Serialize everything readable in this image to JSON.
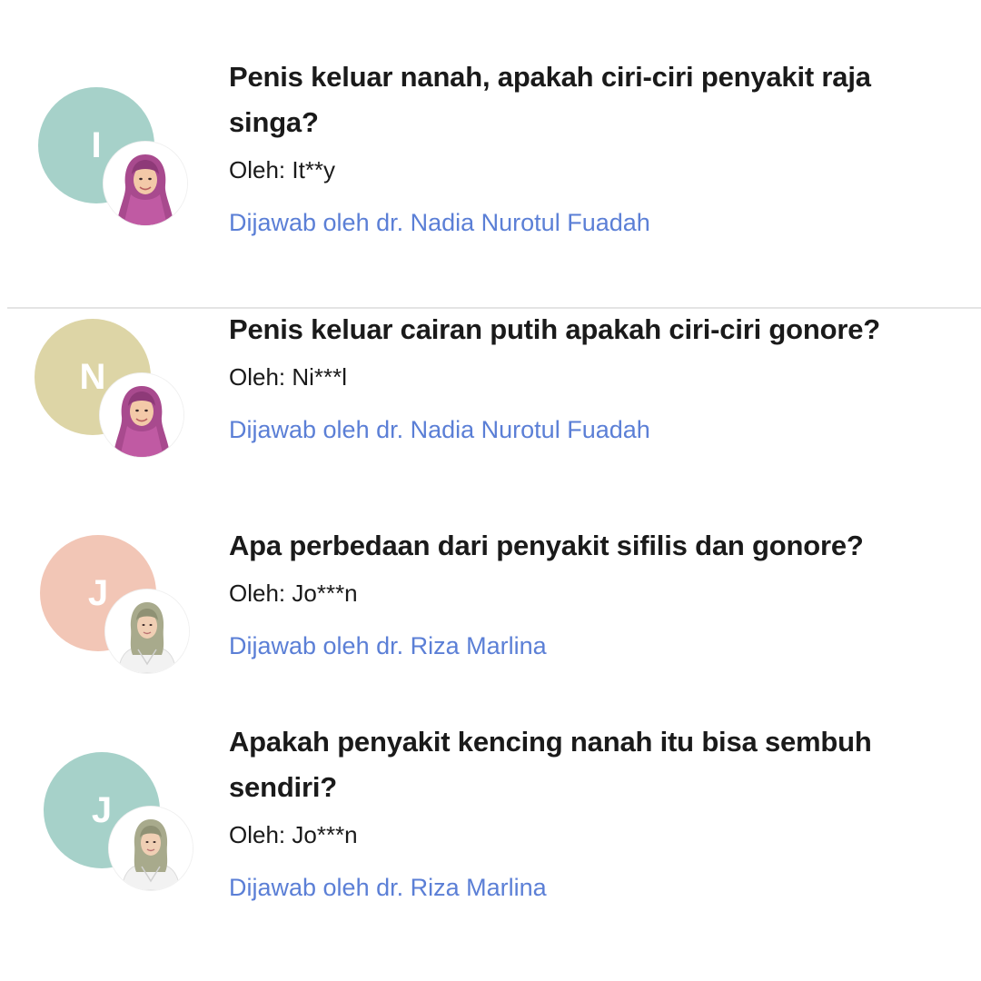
{
  "questions": [
    {
      "title": "Penis keluar nanah, apakah ciri-ciri penyakit raja singa?",
      "author": "Oleh: It**y",
      "initial": "I",
      "initial_color": "#a6d1c9",
      "answered_by": "Dijawab oleh dr. Nadia Nurotul Fuadah",
      "doctor_icon": "doctor-hijab-purple-icon"
    },
    {
      "title": "Penis keluar cairan putih apakah ciri-ciri gonore?",
      "author": "Oleh: Ni***l",
      "initial": "N",
      "initial_color": "#ddd5a6",
      "answered_by": "Dijawab oleh dr. Nadia Nurotul Fuadah",
      "doctor_icon": "doctor-hijab-purple-icon"
    },
    {
      "title": "Apa perbedaan dari penyakit sifilis dan gonore?",
      "author": "Oleh: Jo***n",
      "initial": "J",
      "initial_color": "#f2c6b6",
      "answered_by": "Dijawab oleh dr. Riza Marlina",
      "doctor_icon": "doctor-hijab-white-coat-icon"
    },
    {
      "title": "Apakah penyakit kencing nanah itu bisa sembuh sendiri?",
      "author": "Oleh: Jo***n",
      "initial": "J",
      "initial_color": "#a6d1c9",
      "answered_by": "Dijawab oleh dr. Riza Marlina",
      "doctor_icon": "doctor-hijab-white-coat-icon"
    }
  ],
  "colors": {
    "link": "#5b7fd6",
    "title": "#1a1a1a",
    "divider": "#e4e4e4"
  }
}
